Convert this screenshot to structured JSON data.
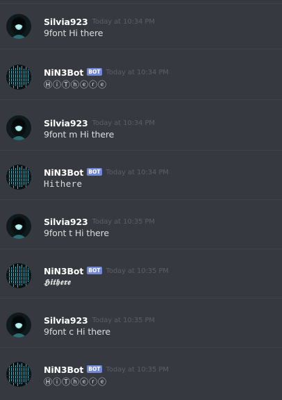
{
  "colors": {
    "background": "#36393f",
    "divider": "#40434a",
    "username": "#ffffff",
    "timestamp": "#5c5f66",
    "message_text": "#dcddde",
    "bot_tag": "#7289da"
  },
  "messages": [
    {
      "author": "Silvia923",
      "is_bot": false,
      "bot_label": "",
      "timestamp": "Today at 10:34 PM",
      "text": "9font Hi there",
      "avatar_icon": "girl-avatar-icon"
    },
    {
      "author": "NiN3Bot",
      "is_bot": true,
      "bot_label": "BOT",
      "timestamp": "Today at 10:34 PM",
      "text": "ⒽⓘⓉⓗⓔⓡⓔ",
      "avatar_icon": "matrix-avatar-icon"
    },
    {
      "author": "Silvia923",
      "is_bot": false,
      "bot_label": "",
      "timestamp": "Today at 10:34 PM",
      "text": "9font m Hi there",
      "avatar_icon": "girl-avatar-icon"
    },
    {
      "author": "NiN3Bot",
      "is_bot": true,
      "bot_label": "BOT",
      "timestamp": "Today at 10:34 PM",
      "text": "𝙷𝚒𝚝𝚑𝚎𝚛𝚎",
      "avatar_icon": "matrix-avatar-icon"
    },
    {
      "author": "Silvia923",
      "is_bot": false,
      "bot_label": "",
      "timestamp": "Today at 10:35 PM",
      "text": "9font t Hi there",
      "avatar_icon": "girl-avatar-icon"
    },
    {
      "author": "NiN3Bot",
      "is_bot": true,
      "bot_label": "BOT",
      "timestamp": "Today at 10:35 PM",
      "text": "𝕳𝖎𝖙𝖍𝖊𝖗𝖊",
      "avatar_icon": "matrix-avatar-icon"
    },
    {
      "author": "Silvia923",
      "is_bot": false,
      "bot_label": "",
      "timestamp": "Today at 10:35 PM",
      "text": "9font c Hi there",
      "avatar_icon": "girl-avatar-icon"
    },
    {
      "author": "NiN3Bot",
      "is_bot": true,
      "bot_label": "BOT",
      "timestamp": "Today at 10:35 PM",
      "text": "ⒽⓘⓉⓗⓔⓡⓔ",
      "avatar_icon": "matrix-avatar-icon"
    }
  ]
}
